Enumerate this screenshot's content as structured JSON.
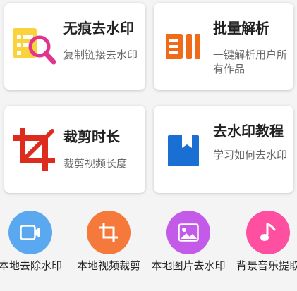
{
  "cards": [
    {
      "title": "无痕去水印",
      "desc": "复制链接去水印",
      "icon": "watermark-search-icon"
    },
    {
      "title": "批量解析",
      "desc": "一键解析用户所有作品",
      "icon": "batch-bars-icon"
    },
    {
      "title": "裁剪时长",
      "desc": "裁剪视频长度",
      "icon": "crop-icon"
    },
    {
      "title": "去水印教程",
      "desc": "学习如何去水印",
      "icon": "bookmark-book-icon"
    }
  ],
  "tools": [
    {
      "label": "本地去除水印",
      "icon": "video-camera-icon",
      "color": "#5aa8f0"
    },
    {
      "label": "本地视频裁剪",
      "icon": "crop-icon",
      "color": "#f5793a"
    },
    {
      "label": "本地图片去水印",
      "icon": "image-icon",
      "color": "#c35be8"
    },
    {
      "label": "背景音乐提取",
      "icon": "music-note-icon",
      "color": "#ff4fa0"
    }
  ],
  "colors": {
    "yellow": "#f9d23c",
    "magenta": "#e2338f",
    "orange": "#f06a1a",
    "red": "#dd2c1e",
    "blue": "#1a6fd3"
  }
}
